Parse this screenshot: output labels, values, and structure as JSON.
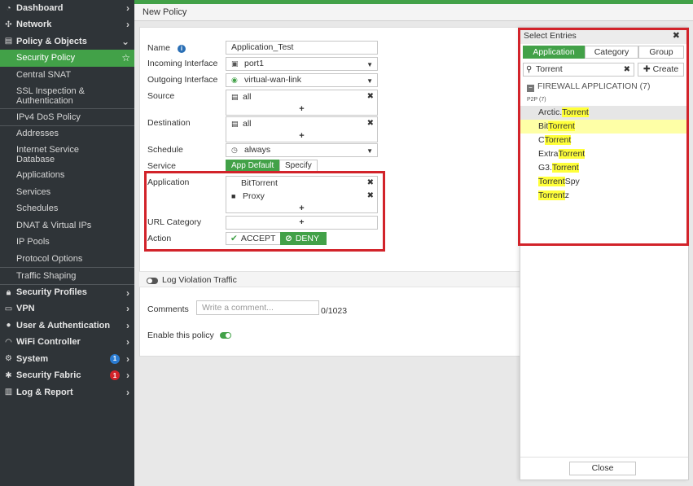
{
  "sidebar": {
    "dashboard": "Dashboard",
    "network": "Network",
    "policy_objects": "Policy & Objects",
    "security_policy": "Security Policy",
    "central_snat": "Central SNAT",
    "ssl_inspection": "SSL Inspection &",
    "ssl_inspection2": "Authentication",
    "ipv4_dos": "IPv4 DoS Policy",
    "addresses": "Addresses",
    "isdb": "Internet Service",
    "isdb2": "Database",
    "applications": "Applications",
    "services": "Services",
    "schedules": "Schedules",
    "dnat": "DNAT & Virtual IPs",
    "ip_pools": "IP Pools",
    "protocol_options": "Protocol Options",
    "traffic_shaping": "Traffic Shaping",
    "security_profiles": "Security Profiles",
    "vpn": "VPN",
    "user_auth": "User & Authentication",
    "wifi": "WiFi Controller",
    "system": "System",
    "system_badge": "1",
    "security_fabric": "Security Fabric",
    "fabric_badge": "1",
    "log_report": "Log & Report"
  },
  "page": {
    "title": "New Policy"
  },
  "form": {
    "name_label": "Name",
    "name_value": "Application_Test",
    "incoming_label": "Incoming Interface",
    "incoming_value": "port1",
    "outgoing_label": "Outgoing Interface",
    "outgoing_value": "virtual-wan-link",
    "source_label": "Source",
    "source_value": "all",
    "destination_label": "Destination",
    "destination_value": "all",
    "schedule_label": "Schedule",
    "schedule_value": "always",
    "service_label": "Service",
    "service_app_default": "App Default",
    "service_specify": "Specify",
    "application_label": "Application",
    "application_items": [
      "BitTorrent",
      "Proxy"
    ],
    "url_category_label": "URL Category",
    "action_label": "Action",
    "action_accept": "ACCEPT",
    "action_deny": "DENY",
    "log_violation": "Log Violation Traffic",
    "comments_label": "Comments",
    "comments_placeholder": "Write a comment...",
    "comments_count": "0/1023",
    "enable_label": "Enable this policy"
  },
  "select_entries": {
    "title": "Select Entries",
    "tabs": [
      "Application",
      "Category",
      "Group"
    ],
    "search_value": "Torrent",
    "create_label": "Create",
    "group_title": "FIREWALL APPLICATION (7)",
    "subgroup": "P2P (7)",
    "items": [
      {
        "pre": "Arctic.",
        "match": "Torrent",
        "post": ""
      },
      {
        "pre": "Bit",
        "match": "Torrent",
        "post": ""
      },
      {
        "pre": "C",
        "match": "Torrent",
        "post": ""
      },
      {
        "pre": "Extra",
        "match": "Torrent",
        "post": ""
      },
      {
        "pre": "G3.",
        "match": "Torrent",
        "post": ""
      },
      {
        "pre": "",
        "match": "Torrent",
        "post": "Spy"
      },
      {
        "pre": "",
        "match": "Torrent",
        "post": "z"
      }
    ],
    "close_label": "Close"
  },
  "colors": {
    "accent": "#42a148",
    "highlight_box": "#d2232a",
    "sidebar_bg": "#2f3438",
    "search_highlight": "#ffff3a"
  }
}
